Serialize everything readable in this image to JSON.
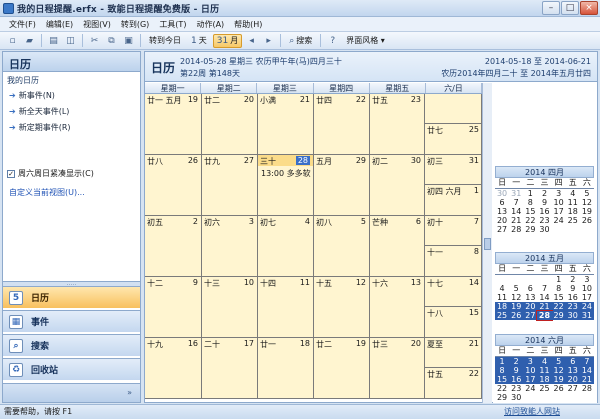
{
  "window": {
    "title": "我的日程提醒.erfx - 致能日程提醒免费版 - 日历",
    "btn_min": "–",
    "btn_max": "□",
    "btn_close": "×"
  },
  "menu": [
    "文件(F)",
    "编辑(E)",
    "视图(V)",
    "转到(G)",
    "工具(T)",
    "动作(A)",
    "帮助(H)"
  ],
  "toolbar": {
    "goto_today": "转到今日",
    "day": "天",
    "day_num": "1",
    "month": "月",
    "month_num": "31",
    "search": "搜索",
    "style": "界面风格 ▾",
    "prev": "◂",
    "next": "▸"
  },
  "sidebar": {
    "title": "日历",
    "section": "我的日历",
    "links": [
      "新事件(N)",
      "新全天事件(L)",
      "新定期事件(R)"
    ],
    "weekend_compact": "周六周日紧凑显示(C)",
    "weekend_checked": "✓",
    "custom_view": "自定义当前视图(U)...",
    "nav": [
      "日历",
      "事件",
      "搜索",
      "回收站"
    ],
    "nav_icons": [
      "5",
      "▦",
      "⌕",
      "♻"
    ],
    "footer": "»",
    "grip": "....."
  },
  "header": {
    "title": "日历",
    "date_line": "2014-05-28  星期三  农历甲午年(马)四月三十",
    "week_line": "第22周  第148天",
    "range": "2014-05-18  至  2014-06-21",
    "lunar_range": "农历2014年四月二十  至  2014年五月廿四"
  },
  "days_of_week": [
    "星期一",
    "星期二",
    "星期三",
    "星期四",
    "星期五",
    "六/日"
  ],
  "weeks": [
    {
      "days": [
        {
          "lunar": "廿一  五月",
          "num": "19"
        },
        {
          "lunar": "廿二",
          "num": "20"
        },
        {
          "lunar": "小满",
          "num": "21"
        },
        {
          "lunar": "廿四",
          "num": "22"
        },
        {
          "lunar": "廿五",
          "num": "23"
        }
      ],
      "sat": {
        "lunar": "",
        "num": ""
      },
      "sun": {
        "lunar": "廿七",
        "num": "25"
      }
    },
    {
      "days": [
        {
          "lunar": "廿八",
          "num": "26"
        },
        {
          "lunar": "廿九",
          "num": "27"
        },
        {
          "lunar": "三十",
          "num": "28",
          "today": true,
          "event": "13:00 多多软"
        },
        {
          "lunar": "五月",
          "num": "29"
        },
        {
          "lunar": "初二",
          "num": "30"
        }
      ],
      "sat": {
        "lunar": "初三",
        "num": "31"
      },
      "sun": {
        "lunar": "初四  六月",
        "num": "1"
      }
    },
    {
      "days": [
        {
          "lunar": "初五",
          "num": "2"
        },
        {
          "lunar": "初六",
          "num": "3"
        },
        {
          "lunar": "初七",
          "num": "4"
        },
        {
          "lunar": "初八",
          "num": "5"
        },
        {
          "lunar": "芒种",
          "num": "6"
        }
      ],
      "sat": {
        "lunar": "初十",
        "num": "7"
      },
      "sun": {
        "lunar": "十一",
        "num": "8"
      }
    },
    {
      "days": [
        {
          "lunar": "十二",
          "num": "9"
        },
        {
          "lunar": "十三",
          "num": "10"
        },
        {
          "lunar": "十四",
          "num": "11"
        },
        {
          "lunar": "十五",
          "num": "12"
        },
        {
          "lunar": "十六",
          "num": "13"
        }
      ],
      "sat": {
        "lunar": "十七",
        "num": "14"
      },
      "sun": {
        "lunar": "十八",
        "num": "15"
      }
    },
    {
      "days": [
        {
          "lunar": "十九",
          "num": "16"
        },
        {
          "lunar": "二十",
          "num": "17"
        },
        {
          "lunar": "廿一",
          "num": "18"
        },
        {
          "lunar": "廿二",
          "num": "19"
        },
        {
          "lunar": "廿三",
          "num": "20"
        }
      ],
      "sat": {
        "lunar": "夏至",
        "num": "21"
      },
      "sun": {
        "lunar": "廿五",
        "num": "22"
      }
    }
  ],
  "mini_dow": [
    "日",
    "一",
    "二",
    "三",
    "四",
    "五",
    "六"
  ],
  "mini_calendars": [
    {
      "title": "2014  四月",
      "rows": [
        [
          {
            "d": "30",
            "o": true
          },
          {
            "d": "31",
            "o": true
          },
          {
            "d": "1"
          },
          {
            "d": "2"
          },
          {
            "d": "3"
          },
          {
            "d": "4"
          },
          {
            "d": "5"
          }
        ],
        [
          {
            "d": "6"
          },
          {
            "d": "7"
          },
          {
            "d": "8"
          },
          {
            "d": "9"
          },
          {
            "d": "10"
          },
          {
            "d": "11"
          },
          {
            "d": "12"
          }
        ],
        [
          {
            "d": "13"
          },
          {
            "d": "14"
          },
          {
            "d": "15"
          },
          {
            "d": "16"
          },
          {
            "d": "17"
          },
          {
            "d": "18"
          },
          {
            "d": "19"
          }
        ],
        [
          {
            "d": "20"
          },
          {
            "d": "21"
          },
          {
            "d": "22"
          },
          {
            "d": "23"
          },
          {
            "d": "24"
          },
          {
            "d": "25"
          },
          {
            "d": "26"
          }
        ],
        [
          {
            "d": "27"
          },
          {
            "d": "28"
          },
          {
            "d": "29"
          },
          {
            "d": "30"
          }
        ]
      ]
    },
    {
      "title": "2014  五月",
      "rows": [
        [
          {
            "d": ""
          },
          {
            "d": ""
          },
          {
            "d": ""
          },
          {
            "d": ""
          },
          {
            "d": "1"
          },
          {
            "d": "2"
          },
          {
            "d": "3"
          }
        ],
        [
          {
            "d": "4"
          },
          {
            "d": "5"
          },
          {
            "d": "6"
          },
          {
            "d": "7"
          },
          {
            "d": "8"
          },
          {
            "d": "9"
          },
          {
            "d": "10"
          }
        ],
        [
          {
            "d": "11"
          },
          {
            "d": "12"
          },
          {
            "d": "13"
          },
          {
            "d": "14"
          },
          {
            "d": "15"
          },
          {
            "d": "16"
          },
          {
            "d": "17"
          }
        ],
        [
          {
            "d": "18",
            "s": true
          },
          {
            "d": "19",
            "s": true
          },
          {
            "d": "20",
            "s": true
          },
          {
            "d": "21",
            "s": true
          },
          {
            "d": "22",
            "s": true
          },
          {
            "d": "23",
            "s": true
          },
          {
            "d": "24",
            "s": true
          }
        ],
        [
          {
            "d": "25",
            "s": true
          },
          {
            "d": "26",
            "s": true
          },
          {
            "d": "27",
            "s": true
          },
          {
            "d": "28",
            "t": true
          },
          {
            "d": "29",
            "s": true
          },
          {
            "d": "30",
            "s": true
          },
          {
            "d": "31",
            "s": true
          }
        ]
      ]
    },
    {
      "title": "2014  六月",
      "rows": [
        [
          {
            "d": "1",
            "s": true
          },
          {
            "d": "2",
            "s": true
          },
          {
            "d": "3",
            "s": true
          },
          {
            "d": "4",
            "s": true
          },
          {
            "d": "5",
            "s": true
          },
          {
            "d": "6",
            "s": true
          },
          {
            "d": "7",
            "s": true
          }
        ],
        [
          {
            "d": "8",
            "s": true
          },
          {
            "d": "9",
            "s": true
          },
          {
            "d": "10",
            "s": true
          },
          {
            "d": "11",
            "s": true
          },
          {
            "d": "12",
            "s": true
          },
          {
            "d": "13",
            "s": true
          },
          {
            "d": "14",
            "s": true
          }
        ],
        [
          {
            "d": "15",
            "s": true
          },
          {
            "d": "16",
            "s": true
          },
          {
            "d": "17",
            "s": true
          },
          {
            "d": "18",
            "s": true
          },
          {
            "d": "19",
            "s": true
          },
          {
            "d": "20",
            "s": true
          },
          {
            "d": "21",
            "s": true
          }
        ],
        [
          {
            "d": "22"
          },
          {
            "d": "23"
          },
          {
            "d": "24"
          },
          {
            "d": "25"
          },
          {
            "d": "26"
          },
          {
            "d": "27"
          },
          {
            "d": "28"
          }
        ],
        [
          {
            "d": "29"
          },
          {
            "d": "30"
          }
        ]
      ]
    }
  ],
  "status": {
    "left": "需要帮助，请按 F1",
    "right": "访问致能人网站"
  },
  "colors": {
    "day_bg": "#fff5d0",
    "today_accent": "#3a6fc8",
    "selected_range": "#2f5fae",
    "nav_active": "#f8c05e"
  }
}
